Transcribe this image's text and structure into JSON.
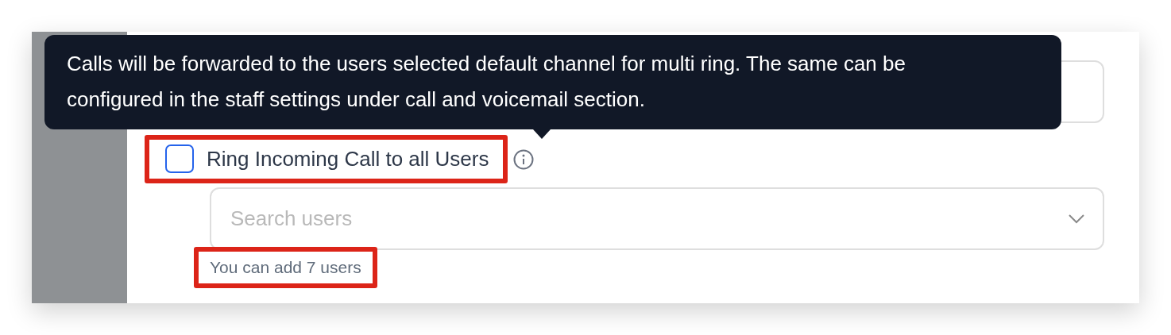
{
  "tooltip": {
    "text": "Calls will be forwarded to the users selected default channel for multi ring. The same can be configured in the staff settings under call and voicemail section."
  },
  "ring_all": {
    "label": "Ring Incoming Call to all Users",
    "checked": false,
    "highlighted": true
  },
  "user_search": {
    "placeholder": "Search users"
  },
  "helper": {
    "text": "You can add 7 users",
    "highlighted": true
  }
}
